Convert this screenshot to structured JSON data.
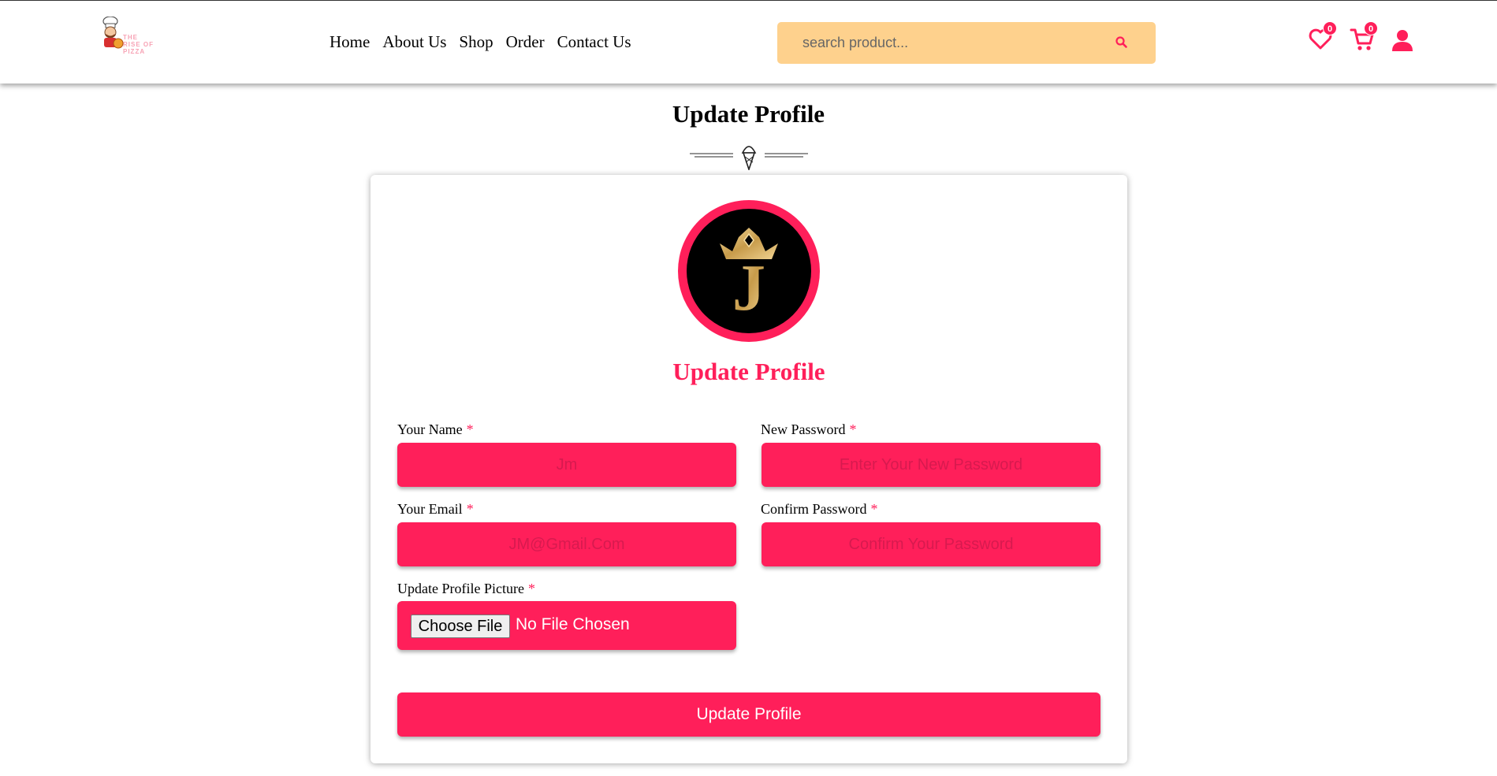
{
  "header": {
    "logo_lines": [
      "THE",
      "RISE OF PIZZA"
    ],
    "nav": [
      "Home",
      "About Us",
      "Shop",
      "Order",
      "Contact Us"
    ],
    "search_placeholder": "search product...",
    "wishlist_count": "0",
    "cart_count": "0"
  },
  "page": {
    "title": "Update Profile"
  },
  "form": {
    "avatar_letter": "J",
    "title": "Update Profile",
    "required_mark": "*",
    "name_label": "Your Name",
    "name_placeholder": "Jm",
    "email_label": "Your Email",
    "email_placeholder": "JM@Gmail.Com",
    "new_password_label": "New Password",
    "new_password_placeholder": "Enter Your New Password",
    "confirm_password_label": "Confirm Password",
    "confirm_password_placeholder": "Confirm Your Password",
    "picture_label": "Update Profile Picture",
    "file_button": "Choose File",
    "file_status": "No File Chosen",
    "submit_label": "Update Profile"
  },
  "colors": {
    "accent": "#ff1f5a",
    "search_bg": "#fed18d",
    "gold": "#d8b56a"
  },
  "icons": [
    "chef-logo-icon",
    "search-icon",
    "heart-icon",
    "cart-icon",
    "user-icon",
    "ice-cream-icon",
    "crown-icon"
  ]
}
